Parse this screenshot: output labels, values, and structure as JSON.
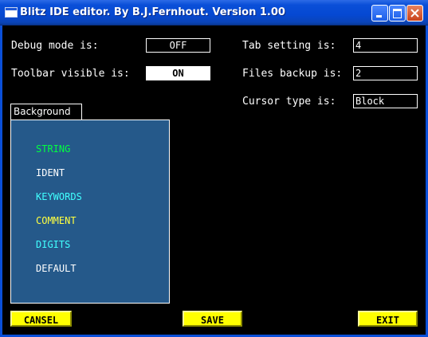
{
  "window": {
    "title": "Blitz IDE editor. By B.J.Fernhout. Version 1.00"
  },
  "settings": {
    "debug_label": "Debug mode is:",
    "debug_value": "OFF",
    "toolbar_label": "Toolbar visible is:",
    "toolbar_value": "ON",
    "tab_label": "Tab setting is:",
    "tab_value": "4",
    "backup_label": "Files backup is:",
    "backup_value": "2",
    "cursor_label": "Cursor type is:",
    "cursor_value": "Block"
  },
  "color_panel": {
    "tab_label": "Background",
    "items": [
      {
        "label": "STRING",
        "color": "#00ff40"
      },
      {
        "label": "IDENT",
        "color": "#ffffff"
      },
      {
        "label": "KEYWORDS",
        "color": "#40ffff"
      },
      {
        "label": "COMMENT",
        "color": "#ffff40"
      },
      {
        "label": "DIGITS",
        "color": "#40ffff"
      },
      {
        "label": "DEFAULT",
        "color": "#ffffff"
      }
    ]
  },
  "buttons": {
    "cancel": "CANSEL",
    "save": "SAVE",
    "exit": "EXIT"
  },
  "colors": {
    "button_bg": "#ffff00",
    "panel_bg": "#25598a",
    "titlebar": "#0548d2"
  }
}
